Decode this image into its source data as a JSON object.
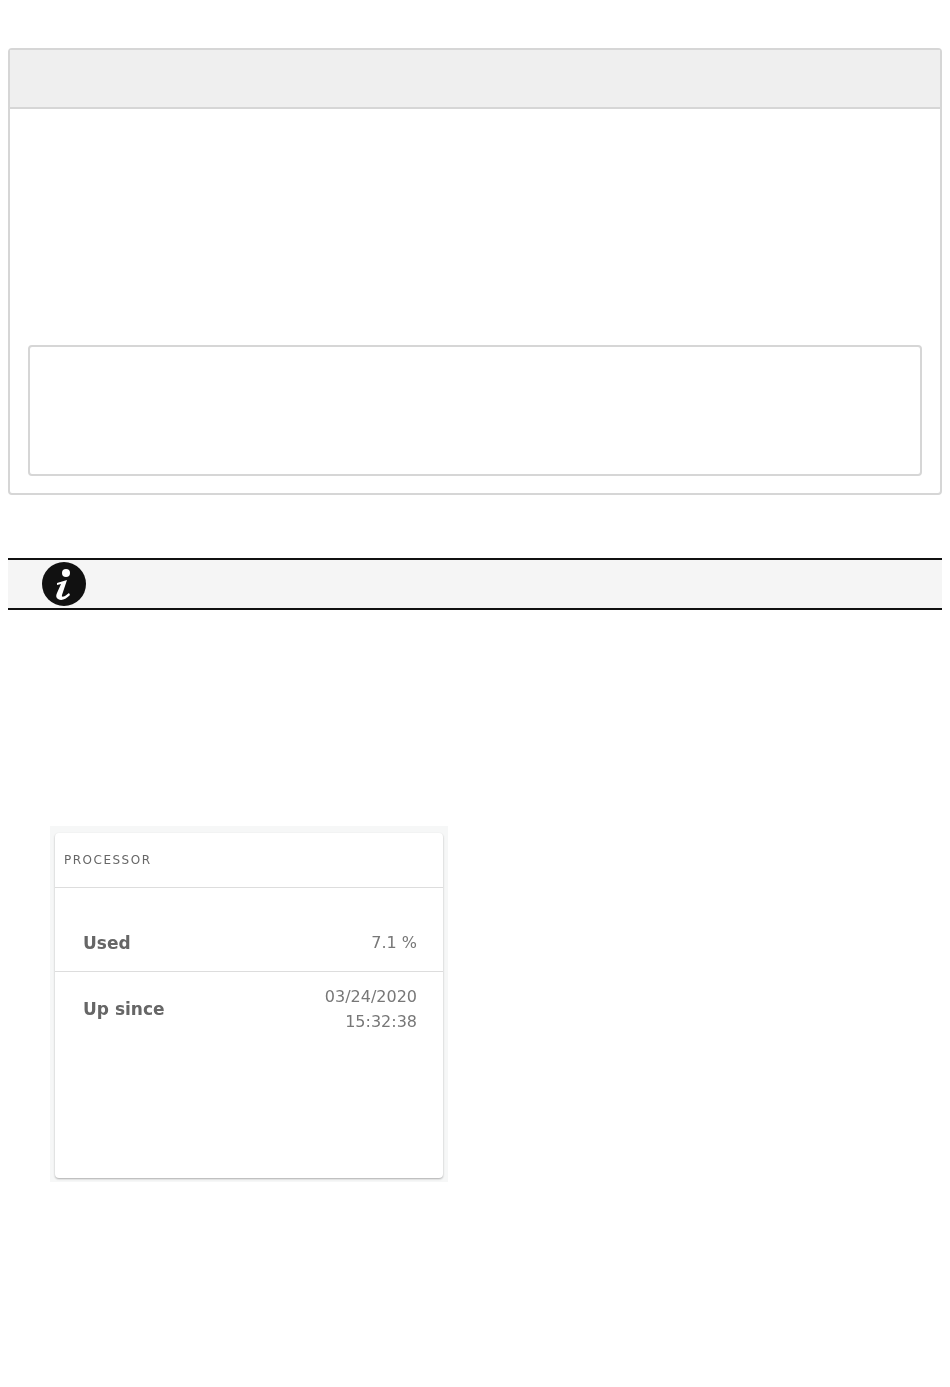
{
  "card": {
    "title": "PROCESSOR",
    "rows": [
      {
        "label": "Used",
        "value_lines": [
          "7.1 %"
        ]
      },
      {
        "label": "Up since",
        "value_lines": [
          "03/24/2020",
          "15:32:38"
        ]
      }
    ]
  }
}
